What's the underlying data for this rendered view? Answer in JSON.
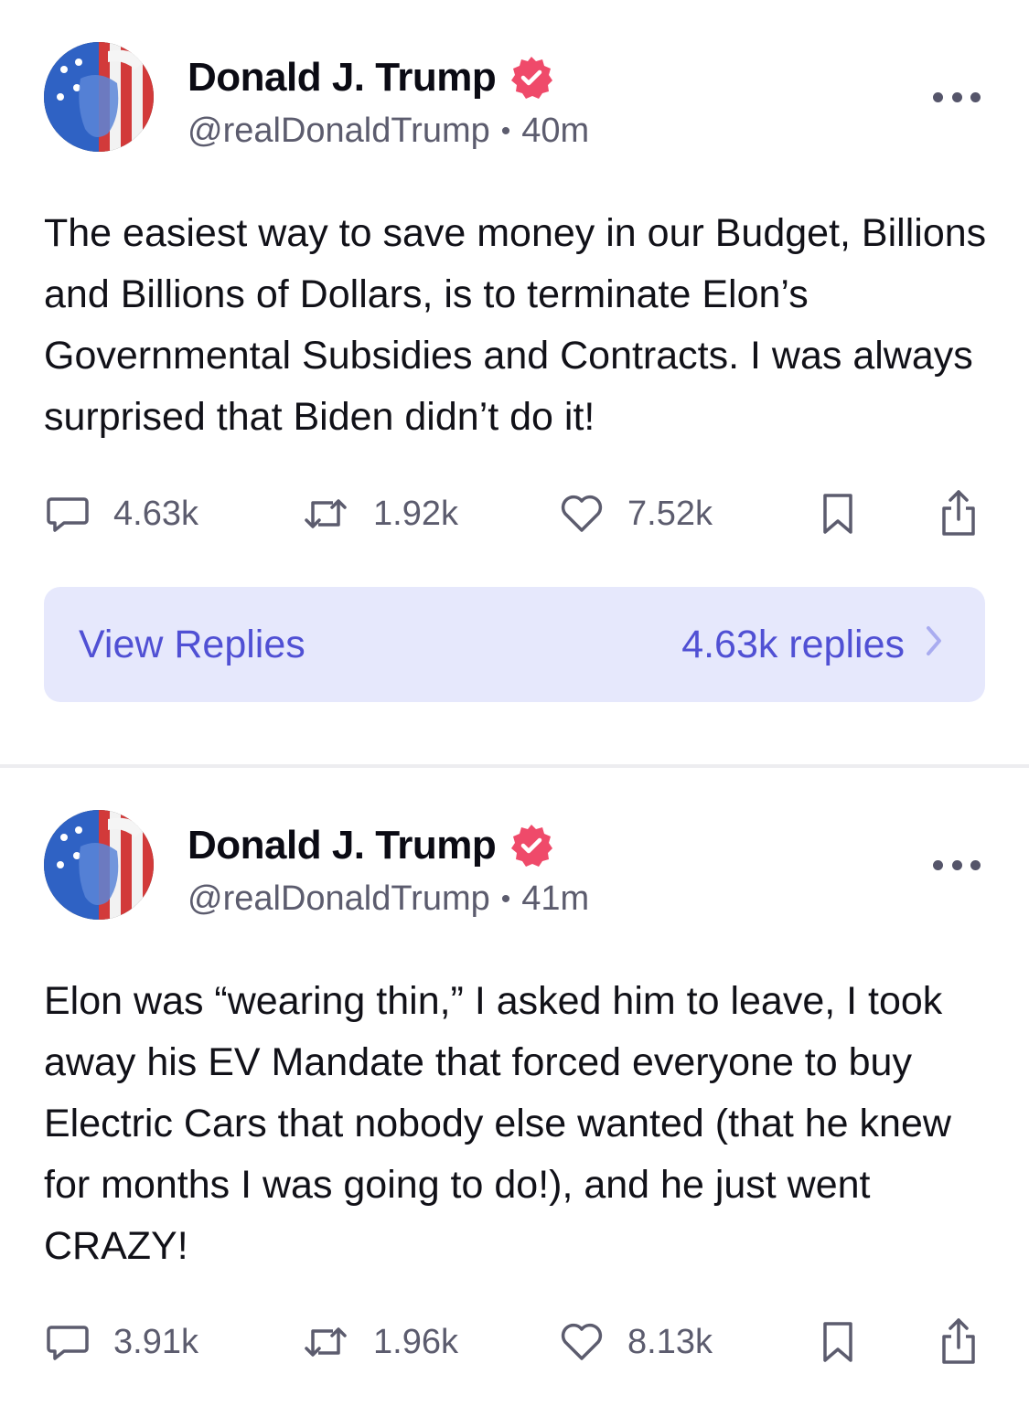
{
  "colors": {
    "accent": "#5050d4",
    "verified_badge": "#ef4a6a",
    "replies_bar_bg": "#e6e8fc",
    "muted_text": "#5c5c6e"
  },
  "posts": [
    {
      "author_name": "Donald J. Trump",
      "handle": "@realDonaldTrump",
      "separator": "•",
      "time": "40m",
      "text": "The easiest way to save money in our Budget, Billions and Billions of Dollars, is to terminate Elon’s Governmental Subsidies and Contracts. I was always surprised that Biden didn’t do it!",
      "replies_count": "4.63k",
      "retruths_count": "1.92k",
      "likes_count": "7.52k",
      "view_replies_label": "View Replies",
      "view_replies_count": "4.63k replies"
    },
    {
      "author_name": "Donald J. Trump",
      "handle": "@realDonaldTrump",
      "separator": "•",
      "time": "41m",
      "text": "Elon was “wearing thin,” I asked him to leave, I took away his EV Mandate that forced everyone to buy Electric Cars that nobody else wanted (that he knew for months I was going to do!), and he just went CRAZY!",
      "replies_count": "3.91k",
      "retruths_count": "1.96k",
      "likes_count": "8.13k"
    }
  ],
  "icons": {
    "verified": "verified-badge-icon",
    "more": "more-options-icon",
    "reply": "reply-bubble-icon",
    "retruth": "retruth-arrows-icon",
    "like": "heart-icon",
    "bookmark": "bookmark-icon",
    "share": "share-icon",
    "chevron": "chevron-right-icon"
  }
}
